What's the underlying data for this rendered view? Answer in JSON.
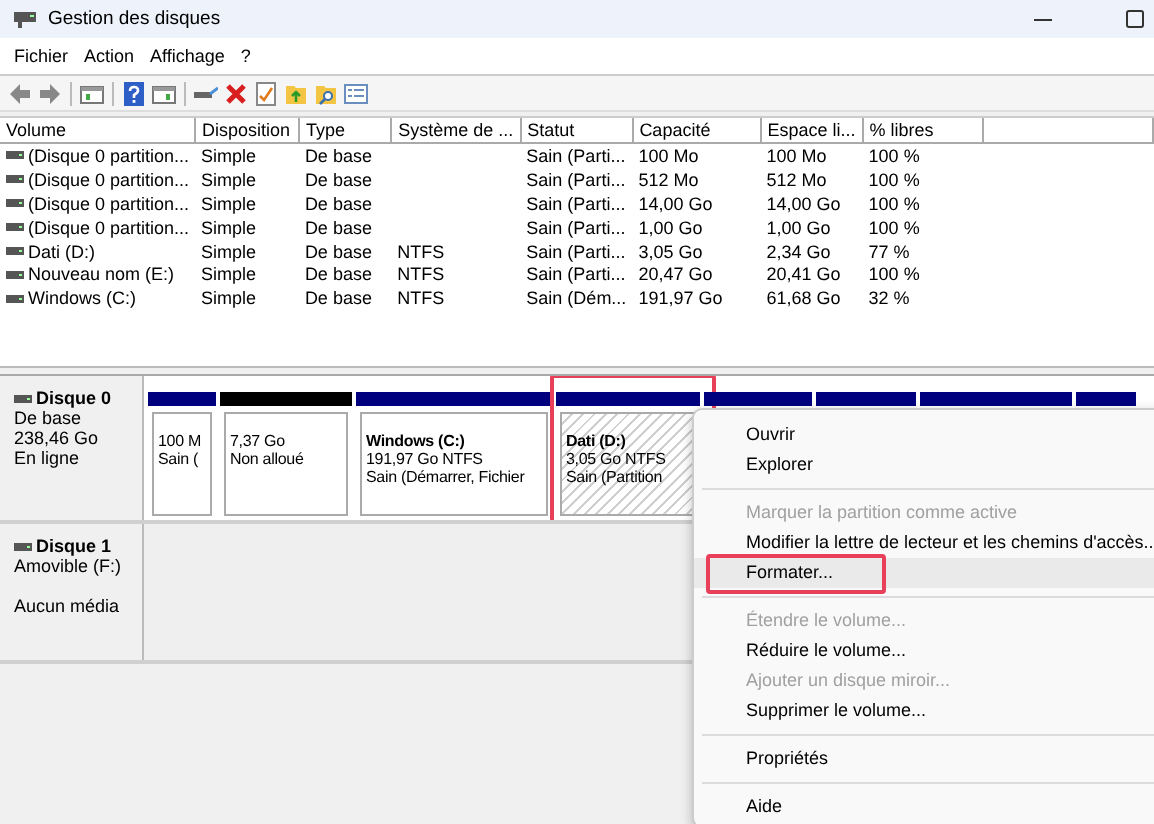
{
  "window": {
    "title": "Gestion des disques"
  },
  "menu_bar": [
    "Fichier",
    "Action",
    "Affichage",
    "?"
  ],
  "table": {
    "columns": [
      "Volume",
      "Disposition",
      "Type",
      "Système de ...",
      "Statut",
      "Capacité",
      "Espace li...",
      "% libres"
    ],
    "rows": [
      [
        "(Disque 0 partition...",
        "Simple",
        "De base",
        "",
        "Sain (Parti...",
        "100 Mo",
        "100 Mo",
        "100 %"
      ],
      [
        "(Disque 0 partition...",
        "Simple",
        "De base",
        "",
        "Sain (Parti...",
        "512 Mo",
        "512 Mo",
        "100 %"
      ],
      [
        "(Disque 0 partition...",
        "Simple",
        "De base",
        "",
        "Sain (Parti...",
        "14,00 Go",
        "14,00 Go",
        "100 %"
      ],
      [
        "(Disque 0 partition...",
        "Simple",
        "De base",
        "",
        "Sain (Parti...",
        "1,00 Go",
        "1,00 Go",
        "100 %"
      ],
      [
        "Dati (D:)",
        "Simple",
        "De base",
        "NTFS",
        "Sain (Parti...",
        "3,05 Go",
        "2,34 Go",
        "77 %"
      ],
      [
        "Nouveau nom (E:)",
        "Simple",
        "De base",
        "NTFS",
        "Sain (Parti...",
        "20,47 Go",
        "20,41 Go",
        "100 %"
      ],
      [
        "Windows (C:)",
        "Simple",
        "De base",
        "NTFS",
        "Sain (Dém...",
        "191,97 Go",
        "61,68 Go",
        "32 %"
      ]
    ]
  },
  "disks": [
    {
      "name": "Disque 0",
      "lines": [
        "De base",
        "238,46 Go"
      ],
      "status": "En ligne",
      "partitions": [
        {
          "kind": "primary",
          "selected": false,
          "highlighted": false,
          "lines": [
            "100 M",
            "Sain ("
          ]
        },
        {
          "kind": "unallocated",
          "selected": false,
          "highlighted": false,
          "lines": [
            "7,37 Go",
            "Non alloué"
          ]
        },
        {
          "kind": "primary",
          "selected": false,
          "highlighted": false,
          "title": "Windows  (C:)",
          "lines": [
            "191,97 Go NTFS",
            "Sain (Démarrer, Fichier"
          ]
        },
        {
          "kind": "primary",
          "selected": true,
          "highlighted": true,
          "title": "Dati  (D:)",
          "lines": [
            "3,05 Go NTFS",
            "Sain (Partition"
          ]
        },
        {
          "kind": "primary"
        },
        {
          "kind": "primary"
        },
        {
          "kind": "primary"
        },
        {
          "kind": "primary"
        }
      ]
    },
    {
      "name": "Disque 1",
      "lines": [
        "Amovible (F:)"
      ],
      "status": "Aucun média"
    }
  ],
  "context_menu": [
    {
      "kind": "item",
      "label": "Ouvrir",
      "disabled": false,
      "highlighted": false
    },
    {
      "kind": "item",
      "label": "Explorer",
      "disabled": false,
      "highlighted": false
    },
    {
      "kind": "separator"
    },
    {
      "kind": "item",
      "label": "Marquer la partition comme active",
      "disabled": true,
      "highlighted": false
    },
    {
      "kind": "item",
      "label": "Modifier la lettre de lecteur et les chemins d'accès...",
      "disabled": false,
      "highlighted": false
    },
    {
      "kind": "item",
      "label": "Formater...",
      "disabled": false,
      "highlighted": true
    },
    {
      "kind": "separator"
    },
    {
      "kind": "item",
      "label": "Étendre le volume...",
      "disabled": true,
      "highlighted": false
    },
    {
      "kind": "item",
      "label": "Réduire le volume...",
      "disabled": false,
      "highlighted": false
    },
    {
      "kind": "item",
      "label": "Ajouter un disque miroir...",
      "disabled": true,
      "highlighted": false
    },
    {
      "kind": "item",
      "label": "Supprimer le volume...",
      "disabled": false,
      "highlighted": false
    },
    {
      "kind": "separator"
    },
    {
      "kind": "item",
      "label": "Propriétés",
      "disabled": false,
      "highlighted": false
    },
    {
      "kind": "separator"
    },
    {
      "kind": "item",
      "label": "Aide",
      "disabled": false,
      "highlighted": false
    }
  ]
}
